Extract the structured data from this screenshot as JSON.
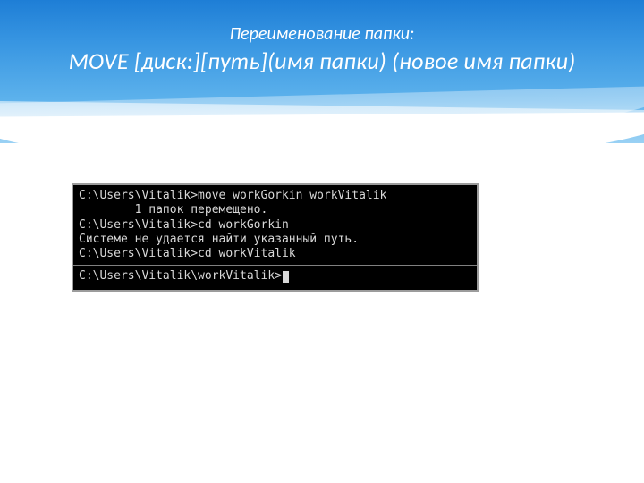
{
  "header": {
    "subtitle": "Переименование папки:",
    "title": "MOVE [диск:][путь](имя папки) (новое имя папки)"
  },
  "console": {
    "lines": [
      "C:\\Users\\Vitalik>move workGorkin workVitalik",
      "        1 папок перемещено.",
      "",
      "C:\\Users\\Vitalik>cd workGorkin",
      "Системе не удается найти указанный путь.",
      "",
      "C:\\Users\\Vitalik>cd workVitalik",
      "",
      "C:\\Users\\Vitalik\\workVitalik>"
    ],
    "separator_after_index": 7
  }
}
